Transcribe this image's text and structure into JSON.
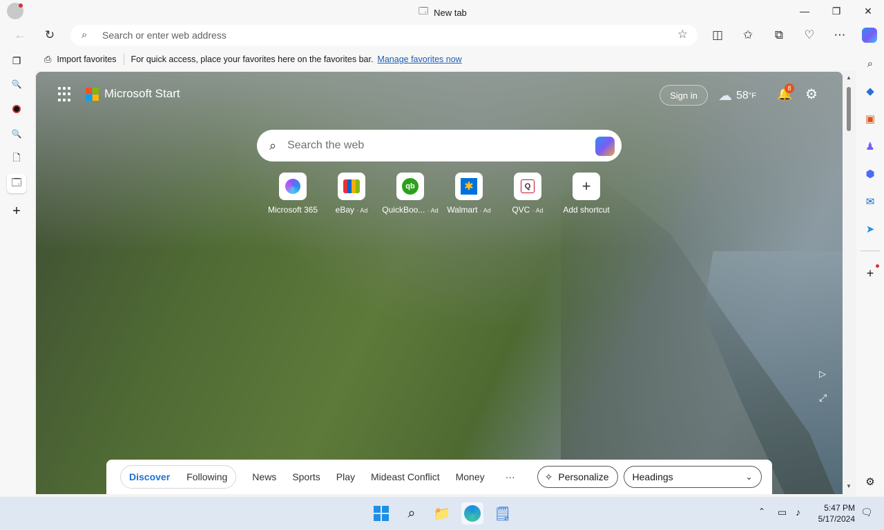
{
  "window": {
    "title": "New tab"
  },
  "toolbar": {
    "address_placeholder": "Search or enter web address"
  },
  "favorites_bar": {
    "import_label": "Import favorites",
    "message": "For quick access, place your favorites here on the favorites bar.",
    "manage_link": "Manage favorites now"
  },
  "page": {
    "brand": "Microsoft Start",
    "sign_in": "Sign in",
    "weather": "58",
    "weather_unit": "°F",
    "notification_count": "8",
    "search_placeholder": "Search the web",
    "shortcuts": [
      {
        "label": "Microsoft 365",
        "ad": ""
      },
      {
        "label": "eBay",
        "ad": "· Ad"
      },
      {
        "label": "QuickBoo...",
        "ad": "· Ad"
      },
      {
        "label": "Walmart",
        "ad": "· Ad"
      },
      {
        "label": "QVC",
        "ad": "· Ad"
      },
      {
        "label": "Add shortcut",
        "ad": ""
      }
    ]
  },
  "feed_nav": {
    "tabs": [
      "Discover",
      "Following"
    ],
    "items": [
      "News",
      "Sports",
      "Play",
      "Mideast Conflict",
      "Money"
    ],
    "more": "···",
    "personalize": "Personalize",
    "headings": "Headings"
  },
  "taskbar": {
    "time": "5:47 PM",
    "date": "5/17/2024"
  },
  "colors": {
    "accent": "#1f6fd1",
    "link": "#1a5fb4",
    "badge": "#e0541f"
  }
}
